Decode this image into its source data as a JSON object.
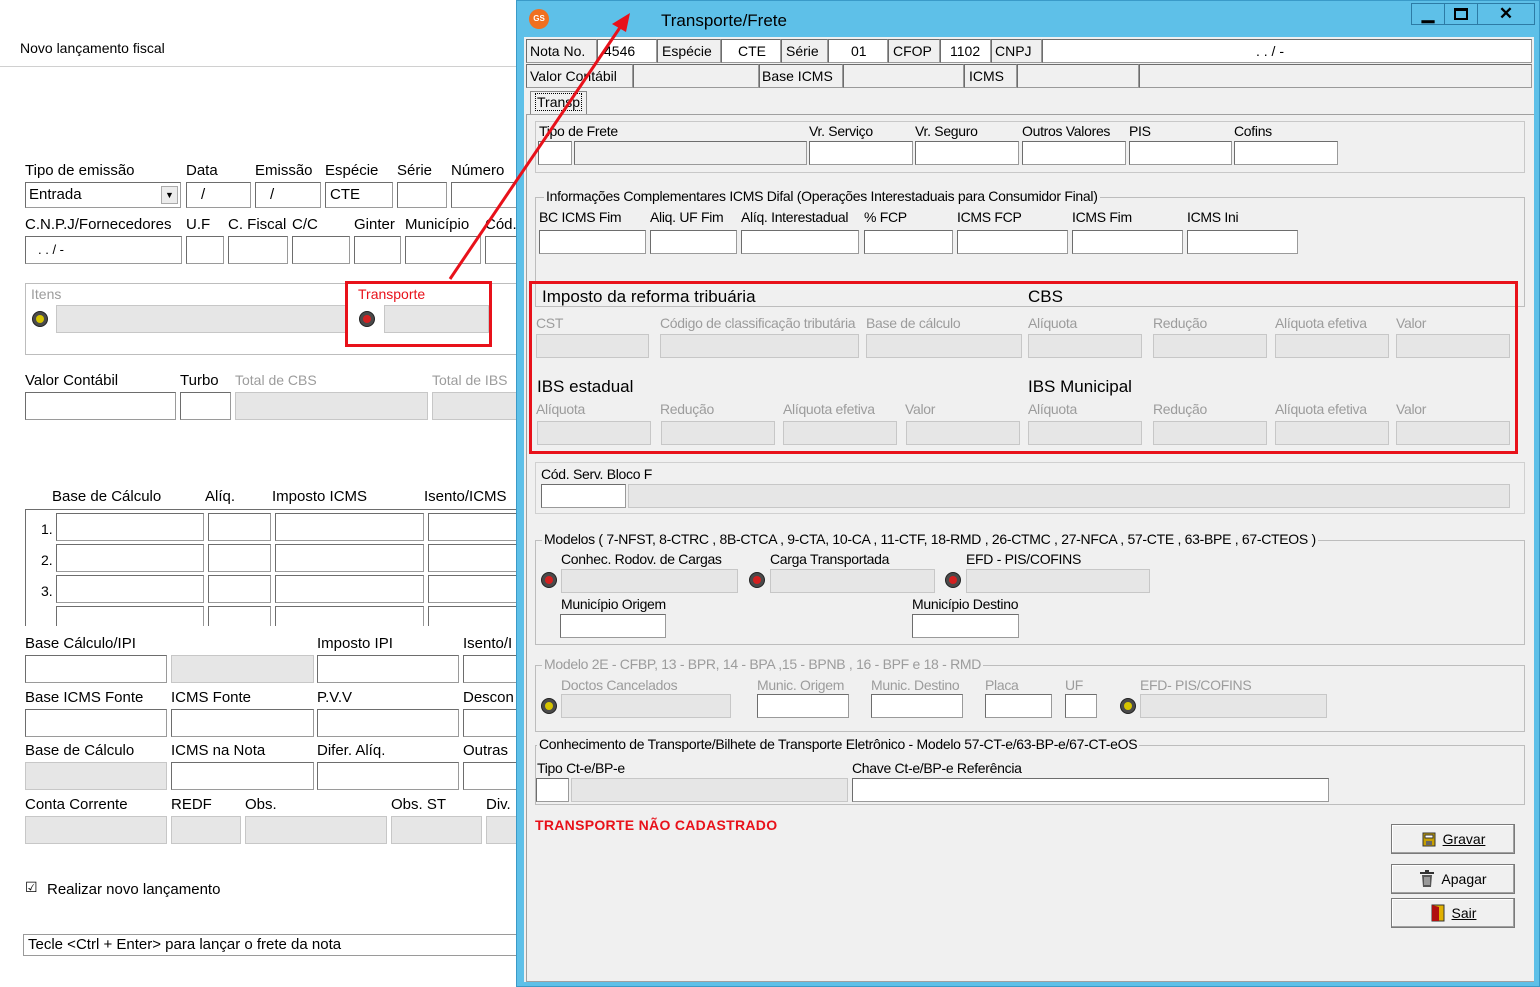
{
  "bg": {
    "title": "Novo lançamento fiscal",
    "lbl_tipo": "Tipo de emissão",
    "lbl_data": "Data",
    "lbl_emissao": "Emissão",
    "lbl_especie": "Espécie",
    "lbl_serie": "Série",
    "lbl_numero": "Número",
    "tipo_value": "Entrada",
    "data_value": "/",
    "emissao_value": "/",
    "especie_value": "CTE",
    "lbl_cnpj": "C.N.P.J/Fornecedores",
    "lbl_uf": "U.F",
    "lbl_cfiscal": "C. Fiscal",
    "lbl_cc": "C/C",
    "lbl_ginter": "Ginter",
    "lbl_municipio": "Município",
    "lbl_cod": "Cód.",
    "cnpj_value": ". . / -",
    "lbl_itens": "Itens",
    "lbl_transporte": "Transporte",
    "lbl_valor_contabil": "Valor Contábil",
    "lbl_turbo": "Turbo",
    "lbl_total_cbs": "Total de CBS",
    "lbl_total_ibs": "Total de IBS",
    "lbl_base_calculo": "Base de Cálculo",
    "lbl_aliq": "Alíq.",
    "lbl_imposto_icms": "Imposto ICMS",
    "lbl_isento_icms": "Isento/ICMS",
    "rows": [
      "1.",
      "2.",
      "3."
    ],
    "lbl_base_ipi": "Base Cálculo/IPI",
    "lbl_imposto_ipi": "Imposto IPI",
    "lbl_isento_ipi": "Isento/I",
    "lbl_base_icms_fonte": "Base ICMS Fonte",
    "lbl_icms_fonte": "ICMS Fonte",
    "lbl_pvv": "P.V.V",
    "lbl_descon": "Descon",
    "lbl_base_calculo2": "Base de Cálculo",
    "lbl_icms_nota": "ICMS na Nota",
    "lbl_difer": "Difer. Alíq.",
    "lbl_outras": "Outras",
    "lbl_conta_corrente": "Conta Corrente",
    "lbl_redf": "REDF",
    "lbl_obs": "Obs.",
    "lbl_obs_st": "Obs. ST",
    "lbl_div": "Div.",
    "chk_novo": "Realizar novo lançamento",
    "status": "Tecle <Ctrl + Enter> para lançar o frete da nota"
  },
  "dlg": {
    "title": "Transporte/Frete",
    "lbl_nota": "Nota No.",
    "nota_value": "4546",
    "lbl_especie": "Espécie",
    "especie_value": "CTE",
    "lbl_serie": "Série",
    "serie_value": "01",
    "lbl_cfop": "CFOP",
    "cfop_value": "1102",
    "lbl_cnpj": "CNPJ",
    "cnpj_value": ". . / -",
    "lbl_valor_contabil": "Valor Contábil",
    "lbl_base_icms": "Base ICMS",
    "lbl_icms": "ICMS",
    "tab": "Transp",
    "lbl_tipo_frete": "Tipo de Frete",
    "lbl_vr_servico": "Vr. Serviço",
    "lbl_vr_seguro": "Vr. Seguro",
    "lbl_outros": "Outros Valores",
    "lbl_pis": "PIS",
    "lbl_cofins": "Cofins",
    "grp_difal": "Informações Complementares ICMS Difal (Operações Interestaduais para Consumidor Final)",
    "lbl_bc_icms_fim": "BC ICMS Fim",
    "lbl_aliq_uf_fim": "Aliq. UF Fim",
    "lbl_aliq_inter": "Alíq. Interestadual",
    "lbl_fcp": "% FCP",
    "lbl_icms_fcp": "ICMS FCP",
    "lbl_icms_fim": "ICMS Fim",
    "lbl_icms_ini": "ICMS Ini",
    "reforma_title": "Imposto da reforma tribuária",
    "cbs_title": "CBS",
    "lbl_cst": "CST",
    "lbl_cod_class": "Código de classificação tributária",
    "lbl_base_calc": "Base de cálculo",
    "lbl_aliquota": "Alíquota",
    "lbl_reducao": "Redução",
    "lbl_aliq_efetiva": "Alíquota efetiva",
    "lbl_valor": "Valor",
    "ibs_est_title": "IBS estadual",
    "ibs_mun_title": "IBS Municipal",
    "lbl_cod_serv": "Cód. Serv. Bloco F",
    "grp_modelos": "Modelos ( 7-NFST,  8-CTRC , 8B-CTCA , 9-CTA, 10-CA , 11-CTF,  18-RMD , 26-CTMC , 27-NFCA , 57-CTE , 63-BPE , 67-CTEOS  )",
    "lbl_conhec": "Conhec. Rodov. de Cargas",
    "lbl_carga": "Carga Transportada",
    "lbl_efd": "EFD - PIS/COFINS",
    "lbl_mun_origem": "Município Origem",
    "lbl_mun_destino": "Município Destino",
    "grp_modelo2e": "Modelo 2E - CFBP, 13 - BPR, 14 - BPA ,15 - BPNB , 16 - BPF e 18 - RMD",
    "lbl_doctos": "Doctos Cancelados",
    "lbl_munic_origem": "Munic. Origem",
    "lbl_munic_destino": "Munic. Destino",
    "lbl_placa": "Placa",
    "lbl_uf": "UF",
    "lbl_efd2": "EFD- PIS/COFINS",
    "grp_cte": "Conhecimento de Transporte/Bilhete de Transporte Eletrônico - Modelo 57-CT-e/63-BP-e/67-CT-eOS",
    "lbl_tipo_cte": "Tipo Ct-e/BP-e",
    "lbl_chave": "Chave Ct-e/BP-e Referência",
    "msg": "TRANSPORTE NÃO CADASTRADO",
    "btn_gravar": "Gravar",
    "btn_apagar": "Apagar",
    "btn_sair": "Sair"
  },
  "colors": {
    "accent": "#e8111a",
    "titlebar": "#5ec0e8",
    "dialog_bg": "#f0f0f0"
  }
}
